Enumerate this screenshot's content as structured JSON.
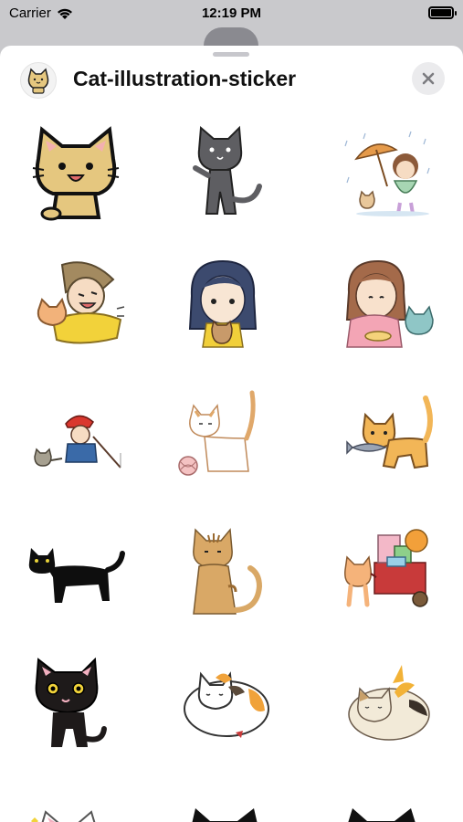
{
  "status_bar": {
    "carrier": "Carrier",
    "time": "12:19 PM",
    "wifi_icon": "wifi-icon",
    "battery_icon": "battery-icon",
    "battery_level": 1.0
  },
  "sheet": {
    "title": "Cat-illustration-sticker",
    "app_icon": "cat-app-icon",
    "close_icon": "close-icon"
  },
  "stickers": [
    {
      "name": "sticker-yellow-cat-smiling"
    },
    {
      "name": "sticker-gray-cat-standing"
    },
    {
      "name": "sticker-girl-umbrella-rain-cat"
    },
    {
      "name": "sticker-boy-hugging-cat"
    },
    {
      "name": "sticker-girl-holding-cat"
    },
    {
      "name": "sticker-girl-feeding-cat"
    },
    {
      "name": "sticker-fisherman-cat"
    },
    {
      "name": "sticker-cat-yarn-ball"
    },
    {
      "name": "sticker-orange-cat-fish"
    },
    {
      "name": "sticker-black-cat-walking"
    },
    {
      "name": "sticker-brown-tabby-sitting"
    },
    {
      "name": "sticker-cat-pulling-cart"
    },
    {
      "name": "sticker-black-cat-cute"
    },
    {
      "name": "sticker-calico-cat-sleeping"
    },
    {
      "name": "sticker-calico-cat-curled"
    }
  ]
}
